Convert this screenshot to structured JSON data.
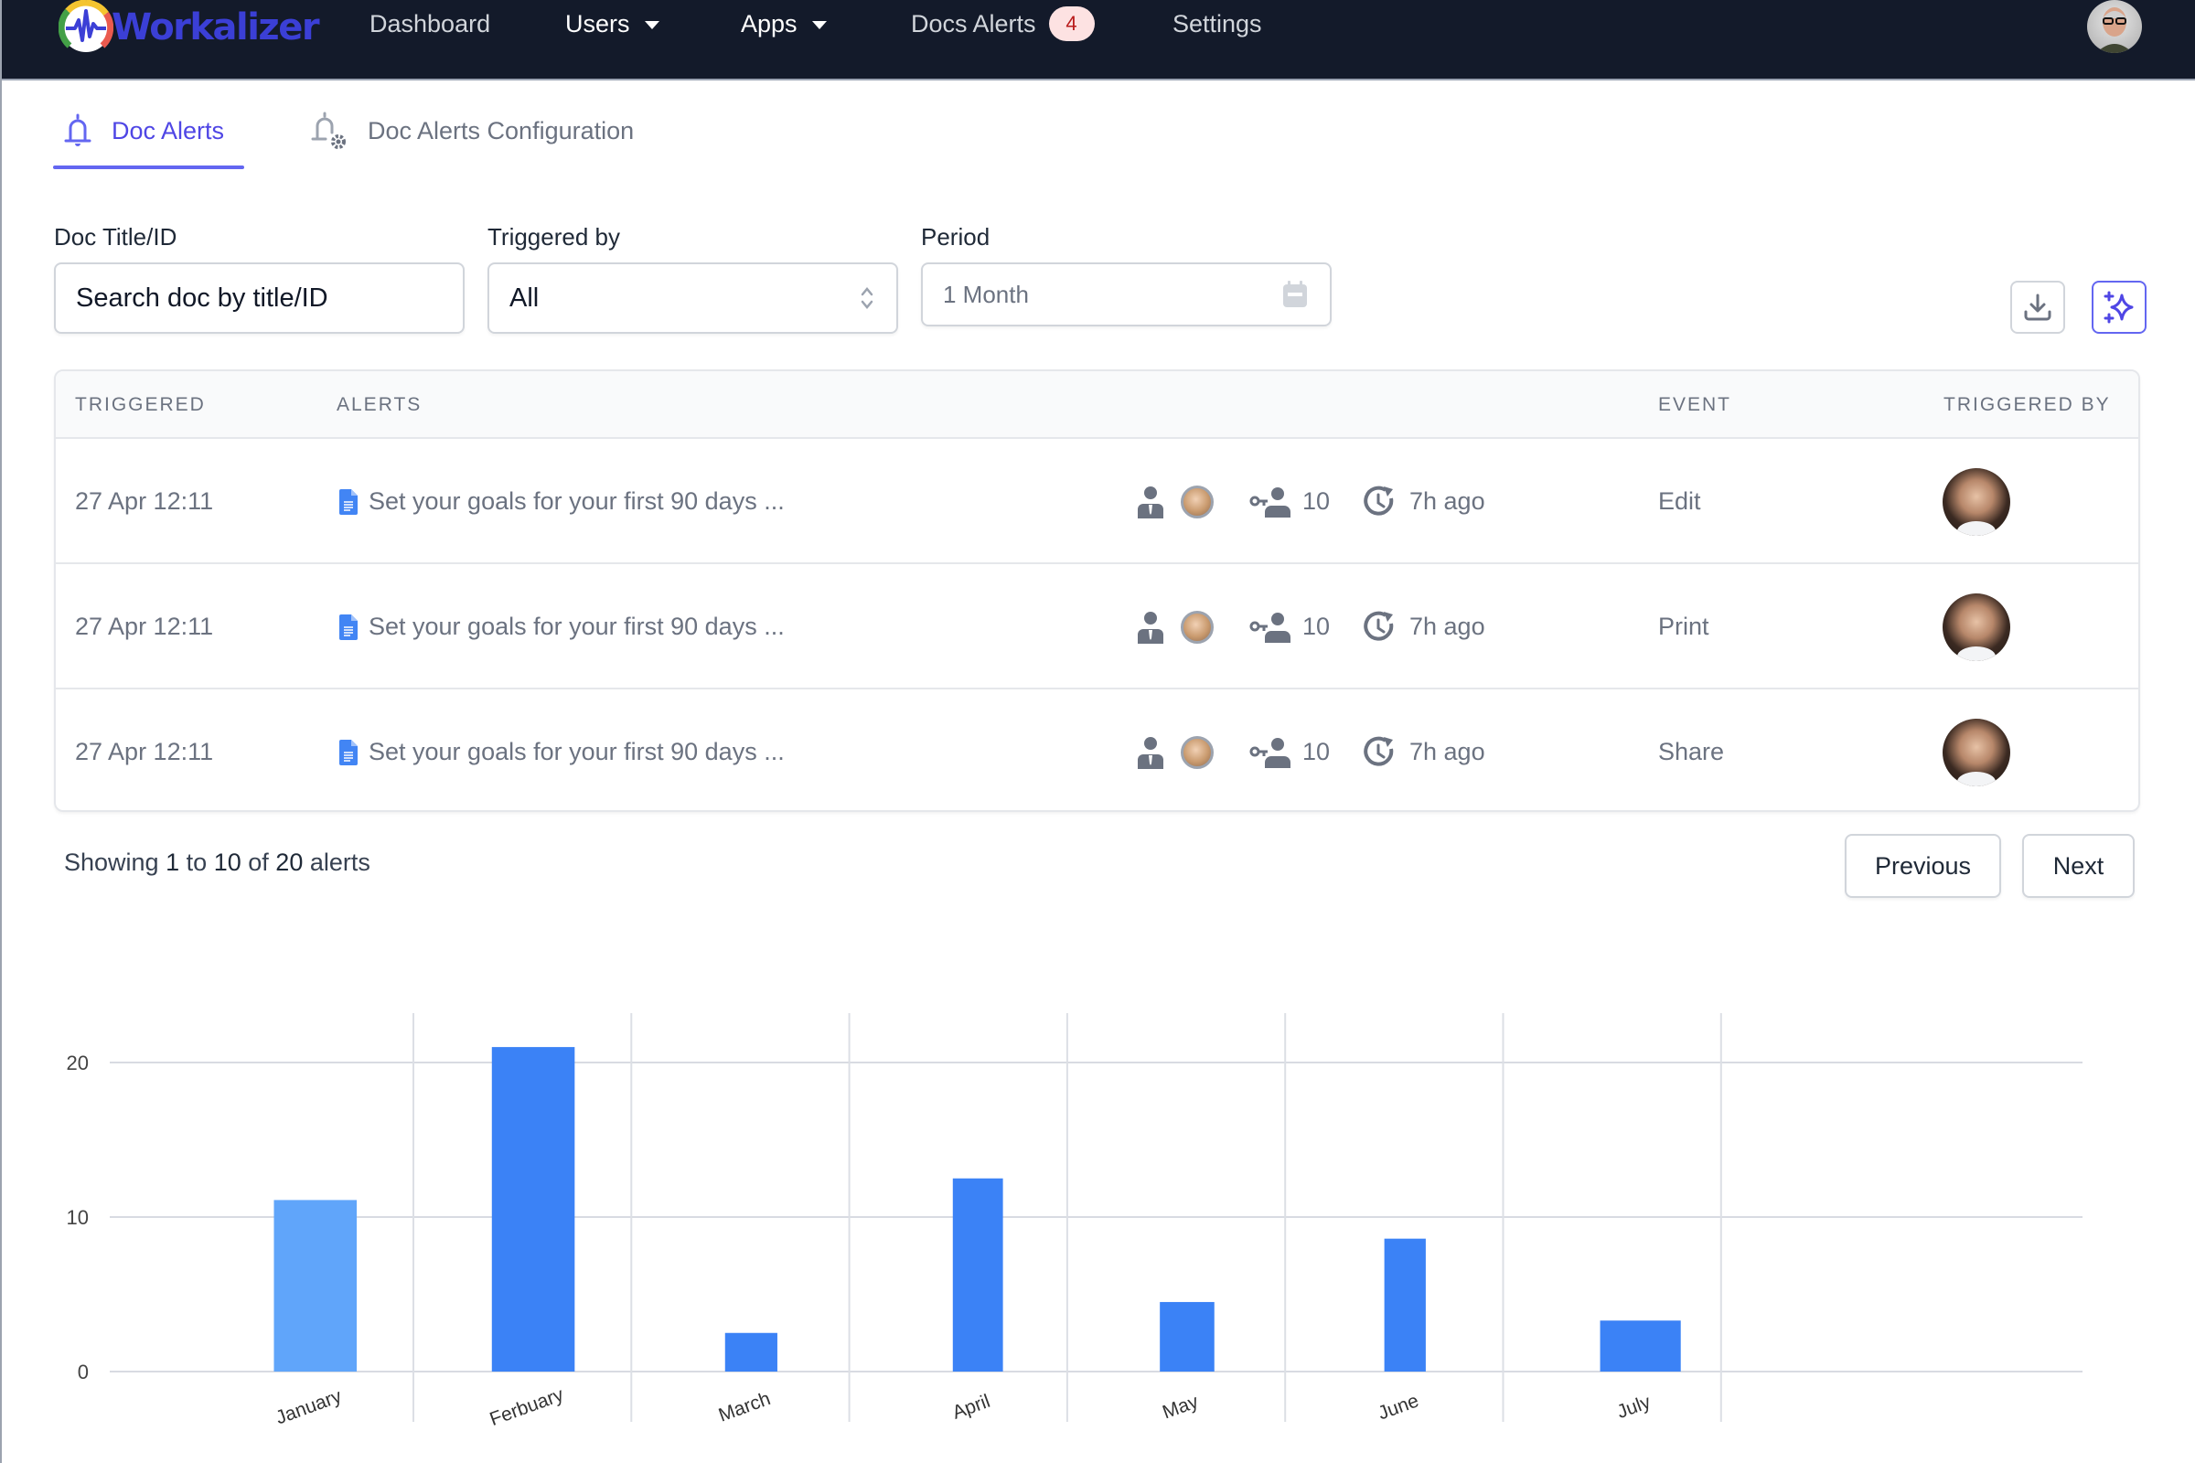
{
  "nav": {
    "brand": "Workalizer",
    "items": [
      {
        "label": "Dashboard",
        "has_caret": false
      },
      {
        "label": "Users",
        "has_caret": true
      },
      {
        "label": "Apps",
        "has_caret": true
      },
      {
        "label": "Docs Alerts",
        "badge": "4"
      },
      {
        "label": "Settings",
        "has_caret": false
      }
    ],
    "avatar_icon": "user-avatar"
  },
  "tabs": [
    {
      "label": "Doc Alerts",
      "icon": "bell-icon",
      "active": true
    },
    {
      "label": "Doc Alerts Configuration",
      "icon": "bell-gear-icon",
      "active": false
    }
  ],
  "filters": {
    "doc_title": {
      "label": "Doc Title/ID",
      "value": "Search doc by title/ID"
    },
    "triggered_by": {
      "label": "Triggered by",
      "value": "All"
    },
    "period": {
      "label": "Period",
      "placeholder": "1 Month"
    },
    "download_icon": "download-icon",
    "ai_icon": "sparkles-icon"
  },
  "table": {
    "headers": [
      "TRIGGERED",
      "ALERTS",
      "EVENT",
      "TRIGGERED BY"
    ],
    "rows": [
      {
        "triggered": "27 Apr 12:11",
        "alert": "Set your goals for your first 90 days ...",
        "access_count": "10",
        "time_ago": "7h ago",
        "event": "Edit"
      },
      {
        "triggered": "27 Apr 12:11",
        "alert": "Set your goals for your first 90 days ...",
        "access_count": "10",
        "time_ago": "7h ago",
        "event": "Print"
      },
      {
        "triggered": "27 Apr 12:11",
        "alert": "Set your goals for your first 90 days ...",
        "access_count": "10",
        "time_ago": "7h ago",
        "event": "Share"
      }
    ]
  },
  "pagination": {
    "prefix": "Showing",
    "from": "1",
    "to_word": "to",
    "to": "10",
    "of_word": "of",
    "total": "20",
    "suffix": "alerts",
    "previous_label": "Previous",
    "next_label": "Next"
  },
  "colors": {
    "nav_bg": "#131a2a",
    "brand": "#3b3fd6",
    "accent": "#4f46e5",
    "bar": "#3b82f6",
    "bar_highlight": "#60a5fa",
    "badge_bg": "#fde2e2",
    "badge_text": "#b91c1c"
  },
  "chart_data": {
    "type": "bar",
    "title": "",
    "xlabel": "",
    "ylabel": "",
    "categories": [
      "January",
      "Ferbuary",
      "March",
      "April",
      "May",
      "June",
      "July"
    ],
    "values": [
      11.1,
      21,
      2.5,
      12.5,
      4.5,
      8.6,
      3.3
    ],
    "highlighted_index": 0,
    "yticks": [
      0,
      10,
      20
    ],
    "ylim": [
      0,
      22
    ],
    "grid": true,
    "legend": "none"
  }
}
